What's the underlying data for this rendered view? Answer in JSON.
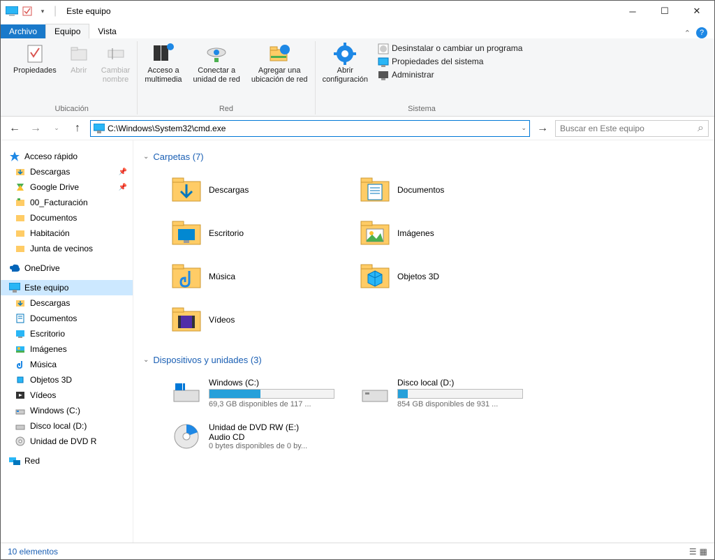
{
  "window_title": "Este equipo",
  "tabs": {
    "file": "Archivo",
    "equipo": "Equipo",
    "vista": "Vista"
  },
  "ribbon": {
    "ubicacion": {
      "label": "Ubicación",
      "propiedades": "Propiedades",
      "abrir": "Abrir",
      "cambiar_nombre": "Cambiar\nnombre"
    },
    "red": {
      "label": "Red",
      "acceso": "Acceso a\nmultimedia",
      "conectar": "Conectar a\nunidad de red",
      "agregar": "Agregar una\nubicación de red"
    },
    "sistema": {
      "label": "Sistema",
      "abrir_config": "Abrir\nconfiguración",
      "desinstalar": "Desinstalar o cambiar un programa",
      "propiedades": "Propiedades del sistema",
      "administrar": "Administrar"
    }
  },
  "address": "C:\\Windows\\System32\\cmd.exe",
  "search_placeholder": "Buscar en Este equipo",
  "sidebar": {
    "quick": "Acceso rápido",
    "quick_items": [
      "Descargas",
      "Google Drive",
      "00_Facturación",
      "Documentos",
      "Habitación",
      "Junta de vecinos"
    ],
    "onedrive": "OneDrive",
    "thispc": "Este equipo",
    "thispc_items": [
      "Descargas",
      "Documentos",
      "Escritorio",
      "Imágenes",
      "Música",
      "Objetos 3D",
      "Vídeos",
      "Windows (C:)",
      "Disco local (D:)",
      "Unidad de DVD R"
    ],
    "network": "Red"
  },
  "sections": {
    "carpetas": {
      "title": "Carpetas (7)",
      "items": [
        "Descargas",
        "Documentos",
        "Escritorio",
        "Imágenes",
        "Música",
        "Objetos 3D",
        "Vídeos"
      ]
    },
    "dispositivos": {
      "title": "Dispositivos y unidades (3)",
      "drives": [
        {
          "name": "Windows (C:)",
          "sub": "69,3 GB disponibles de 117 ...",
          "fill": 41
        },
        {
          "name": "Disco local (D:)",
          "sub": "854 GB disponibles de 931 ...",
          "fill": 8
        },
        {
          "name": "Unidad de DVD RW (E:)\nAudio CD",
          "sub": "0 bytes disponibles de 0 by...",
          "fill": 0,
          "nobar": true
        }
      ]
    }
  },
  "status": "10 elementos"
}
